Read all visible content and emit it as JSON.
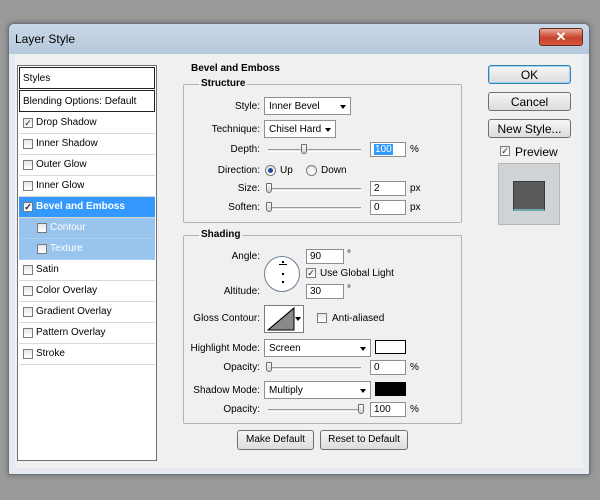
{
  "window": {
    "title": "Layer Style",
    "close_glyph": "✕"
  },
  "styles_list": {
    "header": "Styles",
    "blending_options": "Blending Options: Default",
    "items": [
      {
        "label": "Drop Shadow",
        "checked": true,
        "selected": false,
        "sub": false
      },
      {
        "label": "Inner Shadow",
        "checked": false,
        "selected": false,
        "sub": false
      },
      {
        "label": "Outer Glow",
        "checked": false,
        "selected": false,
        "sub": false
      },
      {
        "label": "Inner Glow",
        "checked": false,
        "selected": false,
        "sub": false
      },
      {
        "label": "Bevel and Emboss",
        "checked": true,
        "selected": true,
        "sub": false
      },
      {
        "label": "Contour",
        "checked": false,
        "selected": false,
        "sub": true
      },
      {
        "label": "Texture",
        "checked": false,
        "selected": false,
        "sub": true
      },
      {
        "label": "Satin",
        "checked": false,
        "selected": false,
        "sub": false
      },
      {
        "label": "Color Overlay",
        "checked": false,
        "selected": false,
        "sub": false
      },
      {
        "label": "Gradient Overlay",
        "checked": false,
        "selected": false,
        "sub": false
      },
      {
        "label": "Pattern Overlay",
        "checked": false,
        "selected": false,
        "sub": false
      },
      {
        "label": "Stroke",
        "checked": false,
        "selected": false,
        "sub": false
      }
    ]
  },
  "bevel": {
    "section_title": "Bevel and Emboss",
    "structure": {
      "group_title": "Structure",
      "style_label": "Style:",
      "style_value": "Inner Bevel",
      "technique_label": "Technique:",
      "technique_value": "Chisel Hard",
      "depth_label": "Depth:",
      "depth_value": "100",
      "depth_unit": "%",
      "direction_label": "Direction:",
      "dir_up": "Up",
      "dir_down": "Down",
      "direction_selected": "Up",
      "size_label": "Size:",
      "size_value": "2",
      "size_unit": "px",
      "soften_label": "Soften:",
      "soften_value": "0",
      "soften_unit": "px"
    },
    "shading": {
      "group_title": "Shading",
      "angle_label": "Angle:",
      "angle_value": "90",
      "angle_unit": "°",
      "use_global_light_label": "Use Global Light",
      "use_global_light_checked": true,
      "altitude_label": "Altitude:",
      "altitude_value": "30",
      "altitude_unit": "°",
      "gloss_contour_label": "Gloss Contour:",
      "anti_aliased_label": "Anti-aliased",
      "anti_aliased_checked": false,
      "highlight_mode_label": "Highlight Mode:",
      "highlight_mode_value": "Screen",
      "highlight_color": "#ffffff",
      "highlight_opacity_label": "Opacity:",
      "highlight_opacity_value": "0",
      "highlight_opacity_unit": "%",
      "shadow_mode_label": "Shadow Mode:",
      "shadow_mode_value": "Multiply",
      "shadow_color": "#000000",
      "shadow_opacity_label": "Opacity:",
      "shadow_opacity_value": "100",
      "shadow_opacity_unit": "%"
    },
    "make_default_label": "Make Default",
    "reset_default_label": "Reset to Default"
  },
  "right_buttons": {
    "ok_label": "OK",
    "cancel_label": "Cancel",
    "new_style_label": "New Style...",
    "preview_label": "Preview",
    "preview_checked": true
  },
  "colors": {
    "selection": "#3399ff",
    "sub_item": "#99c4ee",
    "depth_highlight": "#3399ff"
  }
}
